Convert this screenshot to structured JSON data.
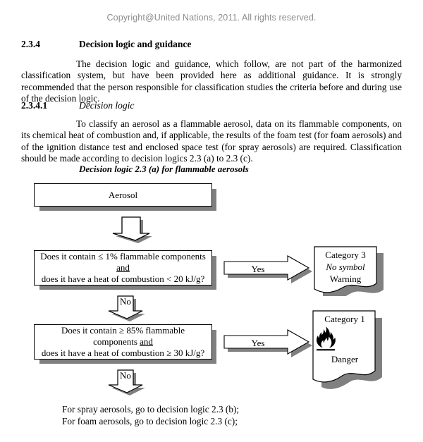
{
  "header": {
    "copyright": "Copyright@United Nations, 2011. All rights reserved."
  },
  "sections": [
    {
      "number": "2.3.4",
      "title": "Decision logic and guidance",
      "style": "bold"
    },
    {
      "number": "2.3.4.1",
      "title": "Decision logic",
      "style": "italic"
    }
  ],
  "paragraphs": {
    "p1": "The decision logic and guidance, which follow, are not part of the harmonized classification system, but have been provided here as additional guidance. It is strongly recommended that the person responsible for classification studies the criteria before and during use of the decision logic.",
    "p2": "To classify an aerosol as a flammable aerosol, data on its flammable components, on its chemical heat of combustion and, if applicable, the results of the foam test (for foam aerosols) and of the ignition distance test and enclosed space test (for spray aerosols) are required. Classification should be made according to decision logics 2.3 (a) to 2.3 (c)."
  },
  "figure": {
    "caption": "Decision logic 2.3 (a) for flammable aerosols",
    "start_box": {
      "label": "Aerosol"
    },
    "decision1": {
      "line1_a": "Does it contain ",
      "line1_b": "≤ 1% flammable components ",
      "line1_c": "and",
      "line2": "does it have a heat of combustion < 20 kJ/g?"
    },
    "decision2": {
      "line1_a": "Does it contain ",
      "line1_b": "≥ 85% flammable components ",
      "line1_c": "and",
      "line2": "does it have a heat of combustion ≥ 30 kJ/g?"
    },
    "yes1_label": "Yes",
    "yes2_label": "Yes",
    "no1_label": "No",
    "no2_label": "No",
    "result_cat3": {
      "line1": "Category 3",
      "line2": "No symbol",
      "line3": "Warning"
    },
    "result_cat1": {
      "line1": "Category 1",
      "symbol": "flame-pictogram",
      "line3": "Danger"
    },
    "bottom_note": "For spray aerosols, go to decision logic 2.3 (b);\nFor foam aerosols, go to decision logic 2.3 (c);"
  },
  "colors": {
    "text": "#000000",
    "copyright": "#8d8d8d",
    "shadow": "#808080",
    "shape_fill": "#ffffff",
    "shape_stroke": "#000000"
  }
}
